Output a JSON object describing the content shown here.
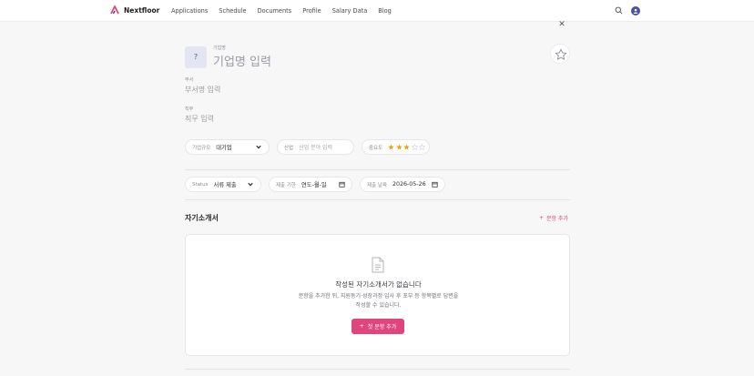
{
  "app": {
    "brand_name": "Nextfloor",
    "brand_color": "#e0467c",
    "nav": [
      "Applications",
      "Schedule",
      "Documents",
      "Profile",
      "Salary Data",
      "Blog"
    ]
  },
  "company": {
    "logo_placeholder": "?",
    "label": "기업명",
    "name_placeholder": "기업명 입력"
  },
  "department": {
    "label": "부서",
    "placeholder": "부서명 입력"
  },
  "job": {
    "label": "직무",
    "placeholder": "직무 입력"
  },
  "company_size": {
    "label": "기업규모",
    "value": "대기업"
  },
  "industry": {
    "label": "산업",
    "placeholder": "산업 분야 입력"
  },
  "importance": {
    "label": "중요도",
    "rating": 3,
    "max": 5
  },
  "status": {
    "label": "Status",
    "value": "서류 제출"
  },
  "deadline": {
    "label": "제출 기한",
    "placeholder": "연도-월-일"
  },
  "submit_date": {
    "label": "제출 날짜",
    "value": "2026-05-26"
  },
  "cover_letter": {
    "title": "자기소개서",
    "add_label": "문항 추가",
    "empty_title": "작성된 자기소개서가 없습니다",
    "empty_desc_line1": "문항을 추가한 뒤, 지원동기·성장과정·입사 후 포부 등 항목별로 답변을",
    "empty_desc_line2": "작성할 수 있습니다.",
    "first_button": "첫 문항 추가"
  },
  "icons": {
    "close": "close-icon",
    "favorite": "star-outline-icon",
    "search": "search-icon",
    "document": "document-icon",
    "plus": "plus-icon",
    "chevron": "chevron-down-icon",
    "calendar": "calendar-icon"
  },
  "colors": {
    "accent": "#e0467c",
    "star_filled": "#e6a817",
    "star_empty": "#d4d4da"
  }
}
